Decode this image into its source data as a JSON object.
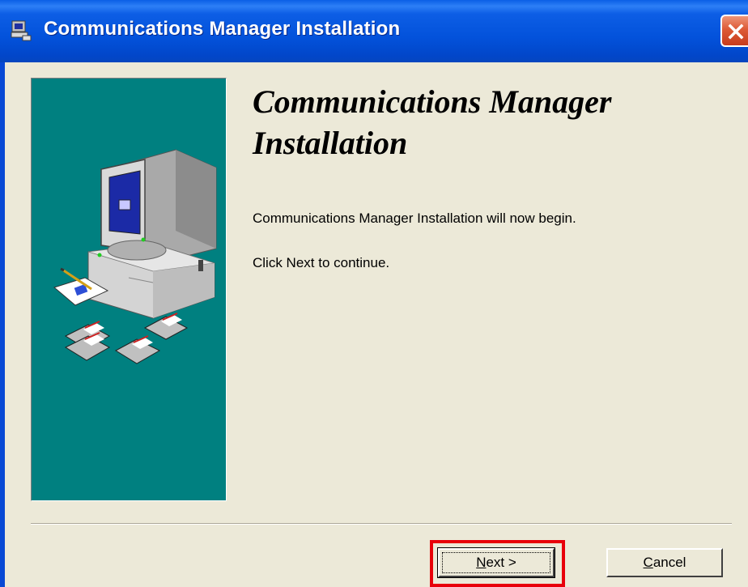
{
  "window": {
    "title": "Communications Manager Installation",
    "title_icon": "installer-computer-icon",
    "close_icon": "close-icon"
  },
  "content": {
    "heading": "Communications Manager Installation",
    "message": "Communications Manager Installation will now begin.",
    "instruction": "Click Next to continue."
  },
  "buttons": {
    "next": {
      "mnemonic": "N",
      "rest": "ext >"
    },
    "cancel": {
      "mnemonic": "C",
      "rest": "ancel"
    }
  },
  "colors": {
    "titlebar": "#0352db",
    "side_panel": "#008080",
    "dialog_bg": "#ece9d8",
    "highlight": "#e8000b"
  }
}
